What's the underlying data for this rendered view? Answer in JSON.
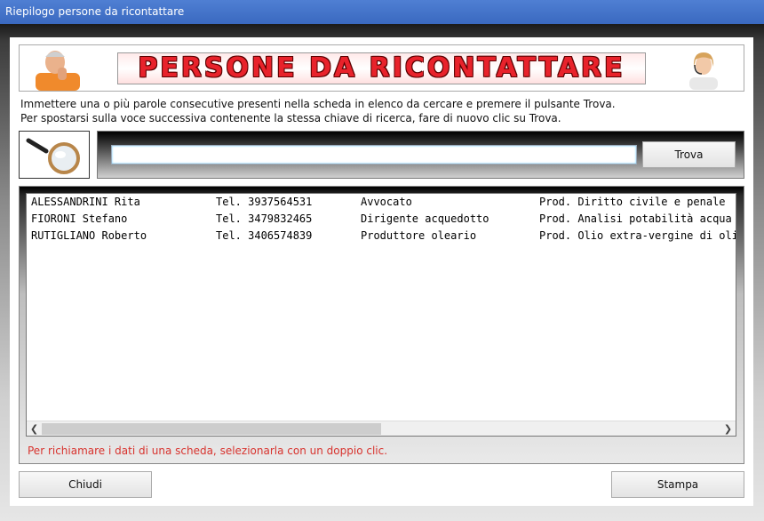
{
  "window": {
    "title": "Riepilogo persone da ricontattare"
  },
  "banner": {
    "title": "PERSONE DA RICONTATTARE"
  },
  "instructions": {
    "line1": "Immettere una o più parole consecutive presenti nella scheda in elenco da cercare e premere il pulsante Trova.",
    "line2": "Per spostarsi sulla voce successiva contenente la stessa chiave di ricerca, fare di nuovo clic su Trova."
  },
  "search": {
    "value": "",
    "placeholder": "",
    "button_label": "Trova"
  },
  "list": {
    "rows": [
      {
        "name": "ALESSANDRINI Rita",
        "phone": "Tel. 3937564531",
        "role": "Avvocato",
        "product": "Prod. Diritto civile e penale"
      },
      {
        "name": "FIORONI Stefano",
        "phone": "Tel. 3479832465",
        "role": "Dirigente acquedotto",
        "product": "Prod. Analisi potabilità acqua"
      },
      {
        "name": "RUTIGLIANO Roberto",
        "phone": "Tel. 3406574839",
        "role": "Produttore oleario",
        "product": "Prod. Olio extra-vergine di oliva"
      }
    ],
    "hint": "Per richiamare i dati di una scheda, selezionarla con un doppio clic."
  },
  "footer": {
    "close_label": "Chiudi",
    "print_label": "Stampa"
  },
  "icons": {
    "search": "magnifier-icon",
    "avatar_left": "man-avatar-icon",
    "avatar_right": "operator-avatar-icon",
    "scroll_left": "chevron-left-icon",
    "scroll_right": "chevron-right-icon"
  },
  "colors": {
    "title_bar": "#3f70c8",
    "banner_text": "#e8222b",
    "hint_text": "#d8332e"
  }
}
